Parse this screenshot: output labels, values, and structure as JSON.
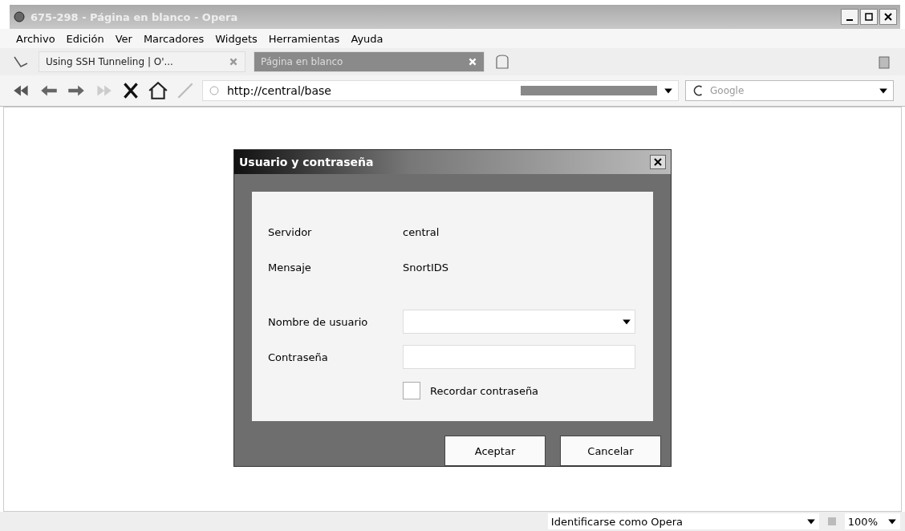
{
  "window": {
    "title": "675-298 - Página en blanco - Opera"
  },
  "menu": [
    "Archivo",
    "Edición",
    "Ver",
    "Marcadores",
    "Widgets",
    "Herramientas",
    "Ayuda"
  ],
  "tabs": [
    {
      "label": "Using SSH Tunneling | O'...",
      "selected": false
    },
    {
      "label": "Página en blanco",
      "selected": true
    }
  ],
  "address": {
    "value": "http://central/base"
  },
  "search": {
    "placeholder": "Google"
  },
  "dialog": {
    "title": "Usuario y contraseña",
    "info": [
      {
        "label": "Servidor",
        "value": "central"
      },
      {
        "label": "Mensaje",
        "value": "SnortIDS"
      }
    ],
    "username_label": "Nombre de usuario",
    "password_label": "Contraseña",
    "remember": {
      "label": "Recordar contraseña",
      "checked": false
    },
    "buttons": [
      "Aceptar",
      "Cancelar"
    ]
  },
  "status_bar": {
    "identity": "Identificarse como Opera",
    "zoom": "100%"
  }
}
